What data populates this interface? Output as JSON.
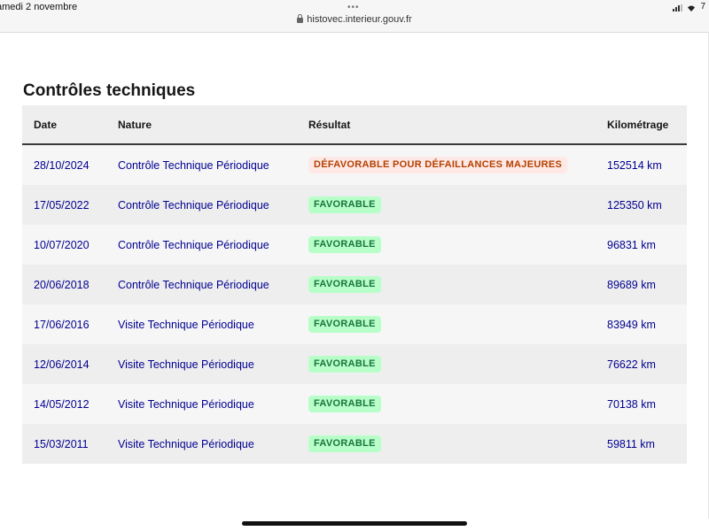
{
  "status_bar": {
    "date": "amedi 2 novembre",
    "battery": "7"
  },
  "browser": {
    "dots": "•••",
    "url": "histovec.interieur.gouv.fr"
  },
  "section": {
    "title": "Contrôles techniques"
  },
  "table": {
    "headers": {
      "date": "Date",
      "nature": "Nature",
      "result": "Résultat",
      "mileage": "Kilométrage"
    },
    "rows": [
      {
        "date": "28/10/2024",
        "nature": "Contrôle Technique Périodique",
        "result": "DÉFAVORABLE POUR DÉFAILLANCES MAJEURES",
        "status": "defavorable",
        "mileage": "152514 km"
      },
      {
        "date": "17/05/2022",
        "nature": "Contrôle Technique Périodique",
        "result": "FAVORABLE",
        "status": "favorable",
        "mileage": "125350 km"
      },
      {
        "date": "10/07/2020",
        "nature": "Contrôle Technique Périodique",
        "result": "FAVORABLE",
        "status": "favorable",
        "mileage": "96831 km"
      },
      {
        "date": "20/06/2018",
        "nature": "Contrôle Technique Périodique",
        "result": "FAVORABLE",
        "status": "favorable",
        "mileage": "89689 km"
      },
      {
        "date": "17/06/2016",
        "nature": "Visite Technique Périodique",
        "result": "FAVORABLE",
        "status": "favorable",
        "mileage": "83949 km"
      },
      {
        "date": "12/06/2014",
        "nature": "Visite Technique Périodique",
        "result": "FAVORABLE",
        "status": "favorable",
        "mileage": "76622 km"
      },
      {
        "date": "14/05/2012",
        "nature": "Visite Technique Périodique",
        "result": "FAVORABLE",
        "status": "favorable",
        "mileage": "70138 km"
      },
      {
        "date": "15/03/2011",
        "nature": "Visite Technique Périodique",
        "result": "FAVORABLE",
        "status": "favorable",
        "mileage": "59811 km"
      }
    ]
  },
  "colors": {
    "link_blue": "#000091",
    "favorable_bg": "#b8fec9",
    "favorable_text": "#18753c",
    "defavorable_bg": "#ffe9e6",
    "defavorable_text": "#b34000"
  }
}
